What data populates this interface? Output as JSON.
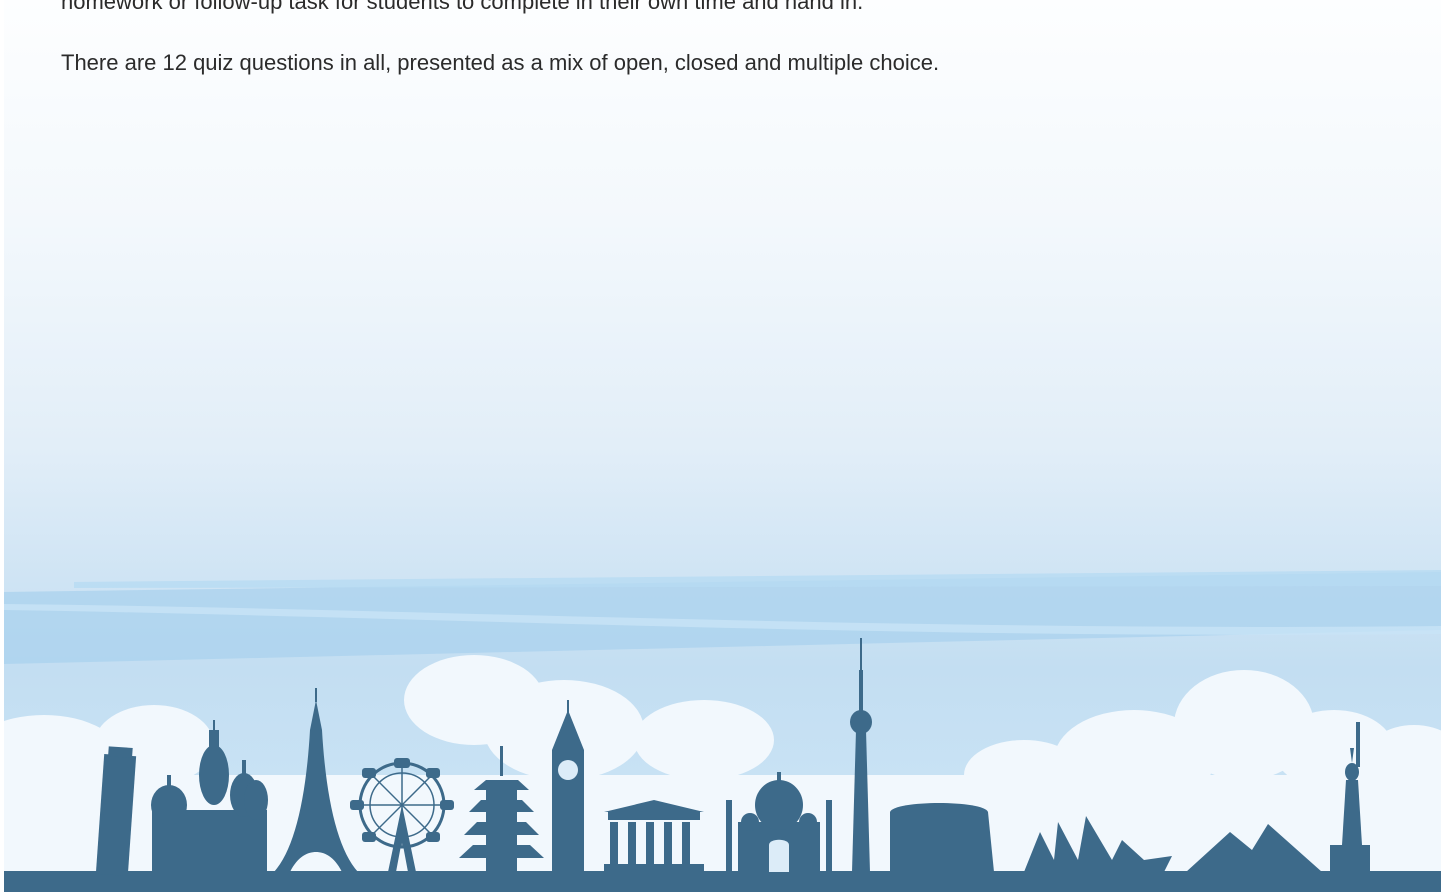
{
  "document": {
    "paragraphs": [
      "homework or follow-up task for students to complete in their own time and hand in.",
      "There are 12 quiz questions in all, presented as a mix of open, closed and multiple choice."
    ]
  },
  "illustration": {
    "description_icons": [
      "leaning-tower-icon",
      "onion-dome-cathedral-icon",
      "eiffel-tower-icon",
      "ferris-wheel-icon",
      "pagoda-icon",
      "clock-tower-icon",
      "greek-temple-icon",
      "domed-mausoleum-icon",
      "tv-tower-icon",
      "colosseum-icon",
      "opera-house-icon",
      "pyramids-icon",
      "statue-icon"
    ],
    "colors": {
      "silhouette": "#3d6a8a",
      "sky_light": "#fdfeff",
      "sky_dark": "#c3def2",
      "cloud": "#f2f8fd",
      "streak": "#a9d2ee"
    }
  }
}
